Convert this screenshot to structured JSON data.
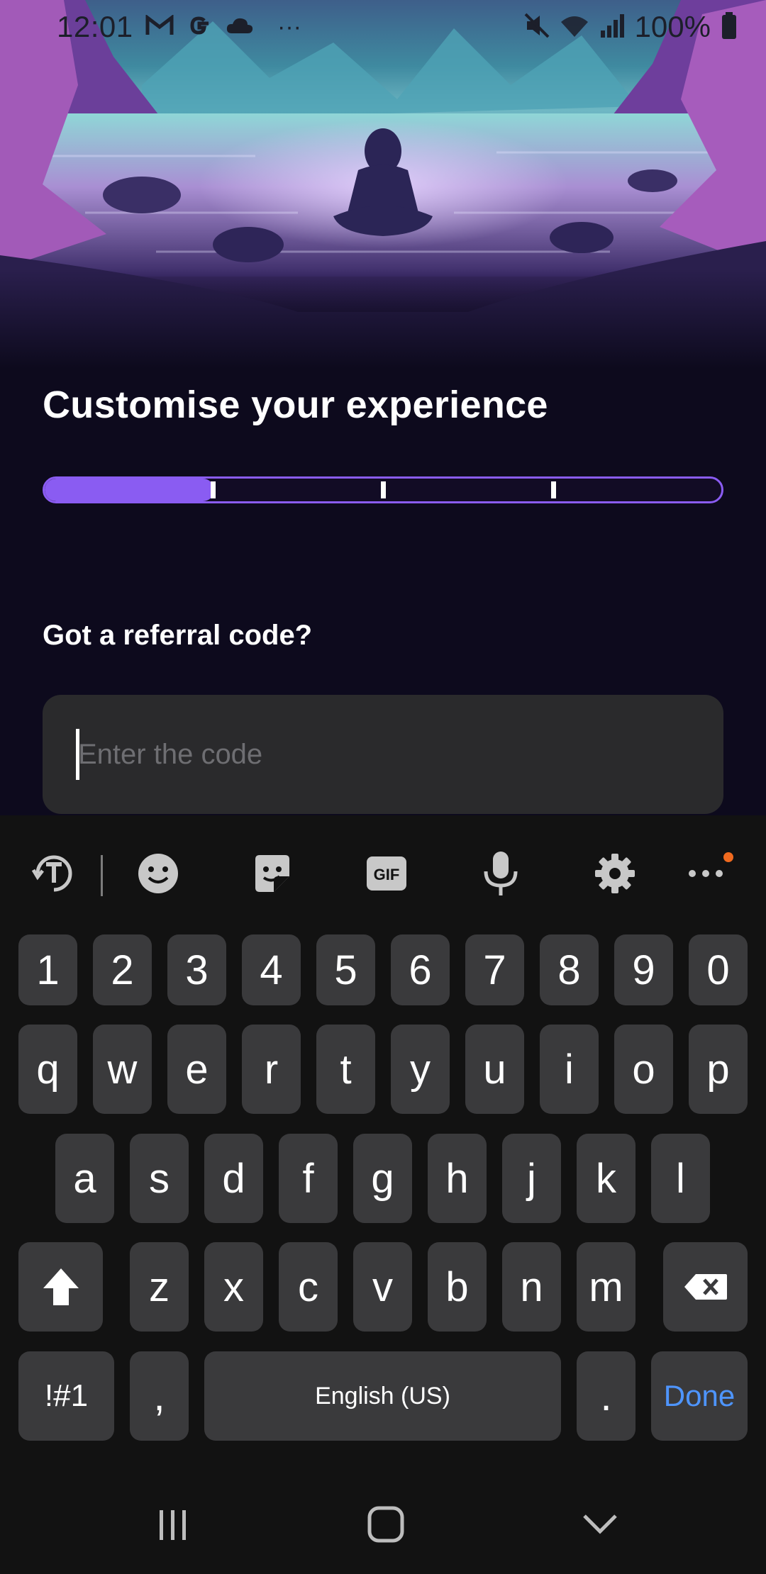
{
  "status_bar": {
    "time": "12:01",
    "battery_percent": "100%",
    "left_icons": [
      "gmail-icon",
      "google-icon",
      "cloud-icon",
      "more-dots-icon"
    ],
    "right_icons": [
      "mute-icon",
      "wifi-icon",
      "signal-icon",
      "battery-icon"
    ]
  },
  "hero": {
    "image": "meditation-landscape-illustration"
  },
  "page": {
    "title": "Customise your experience",
    "progress": {
      "segments": 4,
      "current_step": 1,
      "fill_fraction": 0.25
    },
    "question": "Got a referral code?",
    "code_input": {
      "value": "",
      "placeholder": "Enter the code"
    }
  },
  "colors": {
    "accent": "#8a5cf2",
    "background": "#0d0a1d",
    "input_bg": "#2a2a2c",
    "done_blue": "#4e95ff",
    "notification_dot": "#f06a1f"
  },
  "keyboard": {
    "toolbar": [
      "text-translate-icon",
      "emoji-icon",
      "sticker-icon",
      "gif-icon",
      "microphone-icon",
      "settings-gear-icon",
      "more-options-icon"
    ],
    "gif_label": "GIF",
    "row_numbers": [
      "1",
      "2",
      "3",
      "4",
      "5",
      "6",
      "7",
      "8",
      "9",
      "0"
    ],
    "row_1": [
      "q",
      "w",
      "e",
      "r",
      "t",
      "y",
      "u",
      "i",
      "o",
      "p"
    ],
    "row_2": [
      "a",
      "s",
      "d",
      "f",
      "g",
      "h",
      "j",
      "k",
      "l"
    ],
    "row_3": [
      "z",
      "x",
      "c",
      "v",
      "b",
      "n",
      "m"
    ],
    "symbols_label": "!#1",
    "comma_label": ",",
    "space_label": "English (US)",
    "period_label": ".",
    "done_label": "Done"
  },
  "nav_bar": {
    "buttons": [
      "recent-apps-icon",
      "home-icon",
      "hide-keyboard-icon"
    ]
  }
}
